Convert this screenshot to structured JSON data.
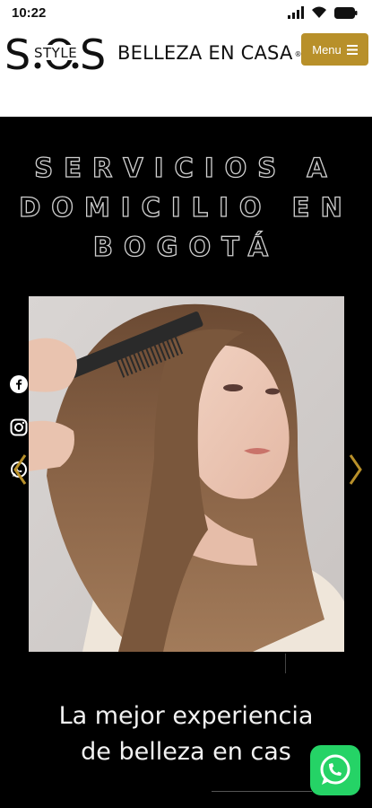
{
  "status_bar": {
    "time": "10:22"
  },
  "header": {
    "logo_main": "S.O.S",
    "logo_badge": "STYLE",
    "brand_text": "BELLEZA EN CASA",
    "registered_mark": "®",
    "menu_label": "Menu"
  },
  "hero": {
    "title_lines": [
      "SERVICIOS A",
      "DOMICILIO EN",
      "BOGOTÁ"
    ],
    "tagline_lines": [
      "La mejor experiencia",
      "de belleza en cas"
    ]
  },
  "social_icons": [
    "facebook-icon",
    "instagram-icon",
    "whatsapp-icon"
  ],
  "colors": {
    "accent": "#b8902a",
    "background": "#000000",
    "whatsapp": "#25d366"
  }
}
